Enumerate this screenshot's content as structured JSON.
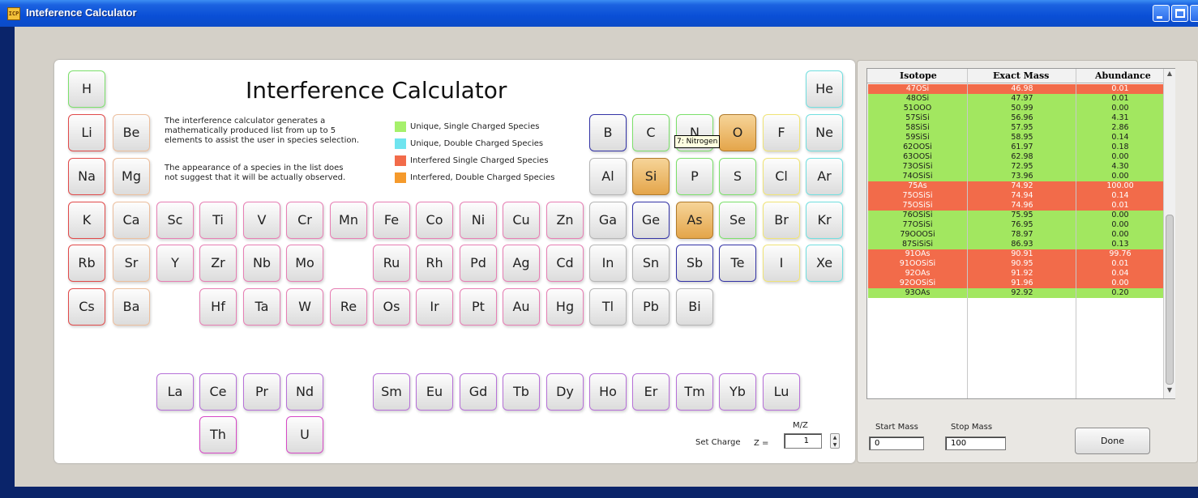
{
  "window": {
    "title": "Inteference Calculator",
    "icon": "app-icon"
  },
  "header": {
    "title": "Interference Calculator",
    "desc1": [
      "The interference calculator generates a",
      "mathematically produced list from up to 5",
      "elements to assist the user in species selection."
    ],
    "desc2": [
      "The appearance of a species in the list does",
      "not suggest that it will be actually observed."
    ]
  },
  "legend": [
    {
      "label": "Unique, Single Charged Species",
      "color": "#a6f06b"
    },
    {
      "label": "Unique, Double Charged Species",
      "color": "#6fe4ef"
    },
    {
      "label": "Interfered Single Charged Species",
      "color": "#f26b4a"
    },
    {
      "label": "Interfered, Double Charged Species",
      "color": "#f59a2c"
    }
  ],
  "elements": {
    "H": "H",
    "He": "He",
    "Li": "Li",
    "Be": "Be",
    "B": "B",
    "C": "C",
    "N": "N",
    "O": "O",
    "F": "F",
    "Ne": "Ne",
    "Na": "Na",
    "Mg": "Mg",
    "Al": "Al",
    "Si": "Si",
    "P": "P",
    "S": "S",
    "Cl": "Cl",
    "Ar": "Ar",
    "K": "K",
    "Ca": "Ca",
    "Sc": "Sc",
    "Ti": "Ti",
    "V": "V",
    "Cr": "Cr",
    "Mn": "Mn",
    "Fe": "Fe",
    "Co": "Co",
    "Ni": "Ni",
    "Cu": "Cu",
    "Zn": "Zn",
    "Ga": "Ga",
    "Ge": "Ge",
    "As": "As",
    "Se": "Se",
    "Br": "Br",
    "Kr": "Kr",
    "Rb": "Rb",
    "Sr": "Sr",
    "Y": "Y",
    "Zr": "Zr",
    "Nb": "Nb",
    "Mo": "Mo",
    "Ru": "Ru",
    "Rh": "Rh",
    "Pd": "Pd",
    "Ag": "Ag",
    "Cd": "Cd",
    "In": "In",
    "Sn": "Sn",
    "Sb": "Sb",
    "Te": "Te",
    "I": "I",
    "Xe": "Xe",
    "Cs": "Cs",
    "Ba": "Ba",
    "Hf": "Hf",
    "Ta": "Ta",
    "W": "W",
    "Re": "Re",
    "Os": "Os",
    "Ir": "Ir",
    "Pt": "Pt",
    "Au": "Au",
    "Hg": "Hg",
    "Tl": "Tl",
    "Pb": "Pb",
    "Bi": "Bi",
    "La": "La",
    "Ce": "Ce",
    "Pr": "Pr",
    "Nd": "Nd",
    "Sm": "Sm",
    "Eu": "Eu",
    "Gd": "Gd",
    "Tb": "Tb",
    "Dy": "Dy",
    "Ho": "Ho",
    "Er": "Er",
    "Tm": "Tm",
    "Yb": "Yb",
    "Lu": "Lu",
    "Th": "Th",
    "U": "U"
  },
  "selected_elements": [
    "O",
    "Si",
    "As"
  ],
  "tooltip": "7: Nitrogen",
  "charge": {
    "set_label": "Set Charge",
    "z_label": "Z =",
    "mz_label": "M/Z",
    "value": "1"
  },
  "table": {
    "headers": [
      "Isotope",
      "Exact Mass",
      "Abundance"
    ],
    "rows": [
      {
        "isotope": "47OSi",
        "mass": "46.98",
        "abundance": "0.01",
        "status": "interfered"
      },
      {
        "isotope": "48OSi",
        "mass": "47.97",
        "abundance": "0.01",
        "status": "unique"
      },
      {
        "isotope": "51OOO",
        "mass": "50.99",
        "abundance": "0.00",
        "status": "unique"
      },
      {
        "isotope": "57SiSi",
        "mass": "56.96",
        "abundance": "4.31",
        "status": "unique"
      },
      {
        "isotope": "58SiSi",
        "mass": "57.95",
        "abundance": "2.86",
        "status": "unique"
      },
      {
        "isotope": "59SiSi",
        "mass": "58.95",
        "abundance": "0.14",
        "status": "unique"
      },
      {
        "isotope": "62OOSi",
        "mass": "61.97",
        "abundance": "0.18",
        "status": "unique"
      },
      {
        "isotope": "63OOSi",
        "mass": "62.98",
        "abundance": "0.00",
        "status": "unique"
      },
      {
        "isotope": "73OSiSi",
        "mass": "72.95",
        "abundance": "4.30",
        "status": "unique"
      },
      {
        "isotope": "74OSiSi",
        "mass": "73.96",
        "abundance": "0.00",
        "status": "unique"
      },
      {
        "isotope": "75As",
        "mass": "74.92",
        "abundance": "100.00",
        "status": "interfered"
      },
      {
        "isotope": "75OSiSi",
        "mass": "74.94",
        "abundance": "0.14",
        "status": "interfered"
      },
      {
        "isotope": "75OSiSi",
        "mass": "74.96",
        "abundance": "0.01",
        "status": "interfered"
      },
      {
        "isotope": "76OSiSi",
        "mass": "75.95",
        "abundance": "0.00",
        "status": "unique"
      },
      {
        "isotope": "77OSiSi",
        "mass": "76.95",
        "abundance": "0.00",
        "status": "unique"
      },
      {
        "isotope": "79OOOSi",
        "mass": "78.97",
        "abundance": "0.00",
        "status": "unique"
      },
      {
        "isotope": "87SiSiSi",
        "mass": "86.93",
        "abundance": "0.13",
        "status": "unique"
      },
      {
        "isotope": "91OAs",
        "mass": "90.91",
        "abundance": "99.76",
        "status": "interfered"
      },
      {
        "isotope": "91OOSiSi",
        "mass": "90.95",
        "abundance": "0.01",
        "status": "interfered"
      },
      {
        "isotope": "92OAs",
        "mass": "91.92",
        "abundance": "0.04",
        "status": "interfered"
      },
      {
        "isotope": "92OOSiSi",
        "mass": "91.96",
        "abundance": "0.00",
        "status": "interfered"
      },
      {
        "isotope": "93OAs",
        "mass": "92.92",
        "abundance": "0.20",
        "status": "unique"
      }
    ],
    "status_colors": {
      "unique": "#a2e760",
      "interfered": "#f26b4a"
    }
  },
  "range": {
    "start_label": "Start Mass",
    "start_value": "0",
    "stop_label": "Stop Mass",
    "stop_value": "100"
  },
  "done_label": "Done"
}
